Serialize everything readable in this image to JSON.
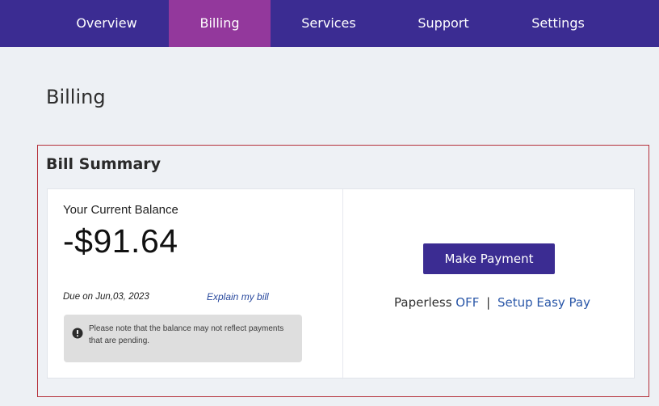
{
  "nav": {
    "tabs": [
      {
        "label": "Overview"
      },
      {
        "label": "Billing",
        "active": true
      },
      {
        "label": "Services"
      },
      {
        "label": "Support"
      },
      {
        "label": "Settings"
      }
    ]
  },
  "page": {
    "title": "Billing"
  },
  "bill_summary": {
    "heading": "Bill Summary",
    "balance_label": "Your Current Balance",
    "balance_amount": "-$91.64",
    "due_date": "Due on Jun,03, 2023",
    "explain_link": "Explain my bill",
    "notice_icon": "exclamation-circle-icon",
    "notice_text": "Please note that the balance may not reflect payments that are pending.",
    "make_payment_label": "Make Payment",
    "paperless_label": "Paperless",
    "paperless_status": "OFF",
    "separator": "|",
    "easy_pay_link": "Setup Easy Pay"
  },
  "colors": {
    "nav_bg": "#3b2c92",
    "nav_active": "#93389c",
    "highlight_border": "#b5303a",
    "link": "#2a57a8"
  }
}
